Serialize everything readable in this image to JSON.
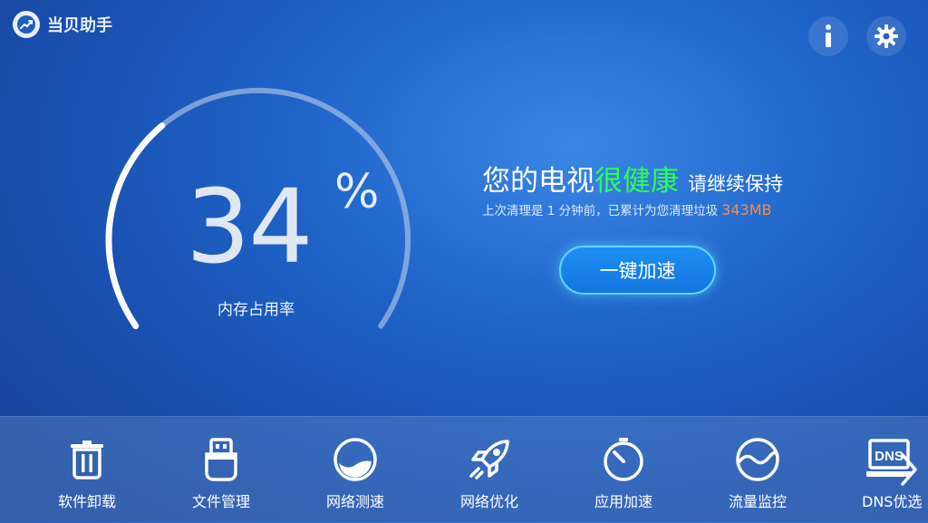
{
  "app": {
    "title": "当贝助手"
  },
  "header": {
    "info_icon": "info-icon",
    "settings_icon": "gear-icon"
  },
  "gauge": {
    "value": "34",
    "unit": "%",
    "label": "内存占用率",
    "fill_fraction": 0.34
  },
  "status": {
    "headline_part1": "您的电视",
    "headline_part2": "很健康",
    "headline_part3": "请继续保持",
    "subline": "上次清理是 1 分钟前，已累计为您清理垃圾",
    "cleaned_size": "343MB"
  },
  "actions": {
    "boost_label": "一键加速"
  },
  "toolbar": {
    "items": [
      {
        "label": "软件卸载",
        "icon": "trash-icon"
      },
      {
        "label": "文件管理",
        "icon": "usb-drive-icon"
      },
      {
        "label": "网络测速",
        "icon": "network-speed-icon"
      },
      {
        "label": "网络优化",
        "icon": "rocket-icon"
      },
      {
        "label": "应用加速",
        "icon": "stopwatch-icon"
      },
      {
        "label": "流量监控",
        "icon": "traffic-wave-icon"
      },
      {
        "label": "DNS优选",
        "icon": "dns-icon"
      }
    ]
  },
  "colors": {
    "accent_green": "#2cff52",
    "accent_orange": "#ff8a3d",
    "button_blue": "#1a84ea"
  }
}
